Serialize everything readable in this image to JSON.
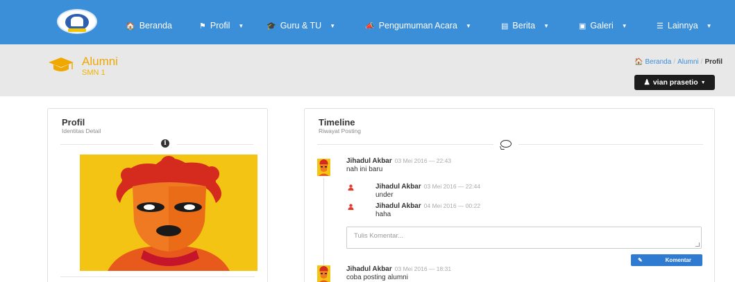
{
  "nav": {
    "items": [
      {
        "label": "Beranda",
        "icon": "home-icon",
        "dropdown": false
      },
      {
        "label": "Profil",
        "icon": "flag-icon",
        "dropdown": true
      },
      {
        "label": "Guru & TU",
        "icon": "graduation-cap-icon",
        "dropdown": true
      },
      {
        "label": "Pengumuman Acara",
        "icon": "bullhorn-icon",
        "dropdown": true
      },
      {
        "label": "Berita",
        "icon": "newspaper-icon",
        "dropdown": true
      },
      {
        "label": "Galeri",
        "icon": "image-icon",
        "dropdown": true
      },
      {
        "label": "Lainnya",
        "icon": "list-icon",
        "dropdown": true
      }
    ]
  },
  "header": {
    "title": "Alumni",
    "subtitle": "SMN 1",
    "breadcrumb": [
      "Beranda",
      "Alumni",
      "Profil"
    ],
    "user_button": "vian prasetio"
  },
  "profil": {
    "title": "Profil",
    "subtitle": "Identitas Detail"
  },
  "timeline": {
    "title": "Timeline",
    "subtitle": "Riwayat Posting",
    "posts": [
      {
        "author": "Jihadul Akbar",
        "date": "03 Mei 2016 — 22:43",
        "text": "nah ini baru"
      },
      {
        "author": "Jihadul Akbar",
        "date": "03 Mei 2016 — 18:31",
        "text": "coba posting alumni"
      }
    ],
    "comments": [
      {
        "author": "Jihadul Akbar",
        "date": "03 Mei 2016 — 22:44",
        "text": "under"
      },
      {
        "author": "Jihadul Akbar",
        "date": "04 Mei 2016 — 00:22",
        "text": "haha"
      }
    ],
    "comment_placeholder": "Tulis Komentar...",
    "comment_button": "Komentar"
  },
  "colors": {
    "navbar": "#3b8ed8",
    "accent": "#f0a800",
    "header_bg": "#e8e8e8",
    "button_primary": "#2f7bd2",
    "user_button": "#1d1d1d"
  }
}
